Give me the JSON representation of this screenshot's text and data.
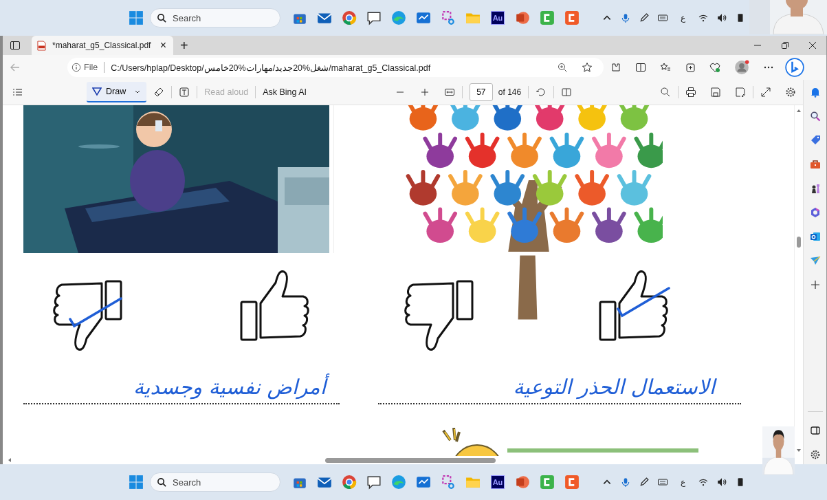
{
  "taskbars": [
    {
      "search": {
        "placeholder": "Search"
      },
      "app_label": "Au",
      "tray_text": "ع"
    },
    {
      "search": {
        "placeholder": "Search"
      },
      "app_label": "Au",
      "tray_text": "ع"
    }
  ],
  "tab": {
    "title": "*maharat_g5_Classical.pdf",
    "close": "×",
    "new": "+"
  },
  "address": {
    "scheme": "File",
    "url": "C:/Users/hplap/Desktop/شغل%20جديد/مهارات%20خامس/maharat_g5_Classical.pdf"
  },
  "pdf_toolbar": {
    "draw": "Draw",
    "read_aloud": {
      "label": "Read aloud",
      "disabled": true
    },
    "ask": "Ask Bing AI",
    "page": "57",
    "of": "of 146"
  },
  "page": {
    "columns": [
      {
        "thumbs": [
          {
            "kind": "up",
            "checked": true
          },
          {
            "kind": "down",
            "checked": false
          }
        ],
        "handwriting": "الاستعمال الحذر التوعية"
      },
      {
        "thumbs": [
          {
            "kind": "up",
            "checked": false
          },
          {
            "kind": "down",
            "checked": true
          }
        ],
        "handwriting": "أمراض نفسية وجسدية"
      }
    ]
  }
}
